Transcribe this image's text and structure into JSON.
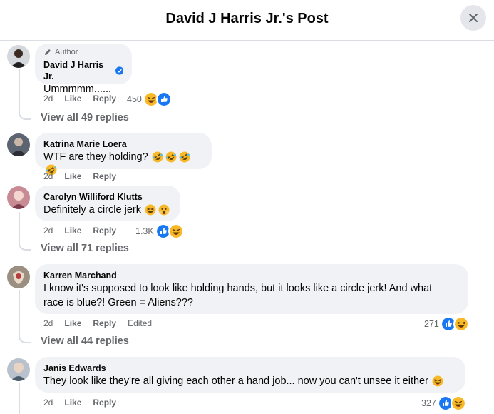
{
  "header": {
    "title": "David J Harris Jr.'s Post"
  },
  "icons": {
    "close": "close-icon",
    "pencil": "pencil-icon",
    "verified": "verified-badge-icon"
  },
  "colors": {
    "like_blue": "#1877f2",
    "haha_yellow": "#f7b928",
    "bubble_bg": "#f0f2f5",
    "muted": "#65676b"
  },
  "comments": [
    {
      "author_badge": "Author",
      "name": "David J Harris Jr.",
      "text": "Ummmmm......",
      "time": "2d",
      "like": "Like",
      "reply": "Reply",
      "reaction_count": "450",
      "view_replies": "View all 49 replies"
    },
    {
      "name": "Katrina Marie Loera",
      "text": "WTF are they holding?",
      "time": "2d",
      "like": "Like",
      "reply": "Reply"
    },
    {
      "name": "Carolyn Williford Klutts",
      "text": "Definitely a circle jerk",
      "time": "2d",
      "like": "Like",
      "reply": "Reply",
      "reaction_count": "1.3K",
      "view_replies": "View all 71 replies"
    },
    {
      "name": "Karren Marchand",
      "text_line1": "I know it's supposed to look like holding hands, but it looks like a circle jerk! And what",
      "text_line2": "race is blue?! Green = Aliens???",
      "time": "2d",
      "like": "Like",
      "reply": "Reply",
      "edited": "Edited",
      "reaction_count": "271",
      "view_replies": "View all 44 replies"
    },
    {
      "name": "Janis Edwards",
      "text": "They look like they're all giving each other a hand job... now you can't unsee it either",
      "time": "2d",
      "like": "Like",
      "reply": "Reply",
      "reaction_count": "327"
    }
  ]
}
